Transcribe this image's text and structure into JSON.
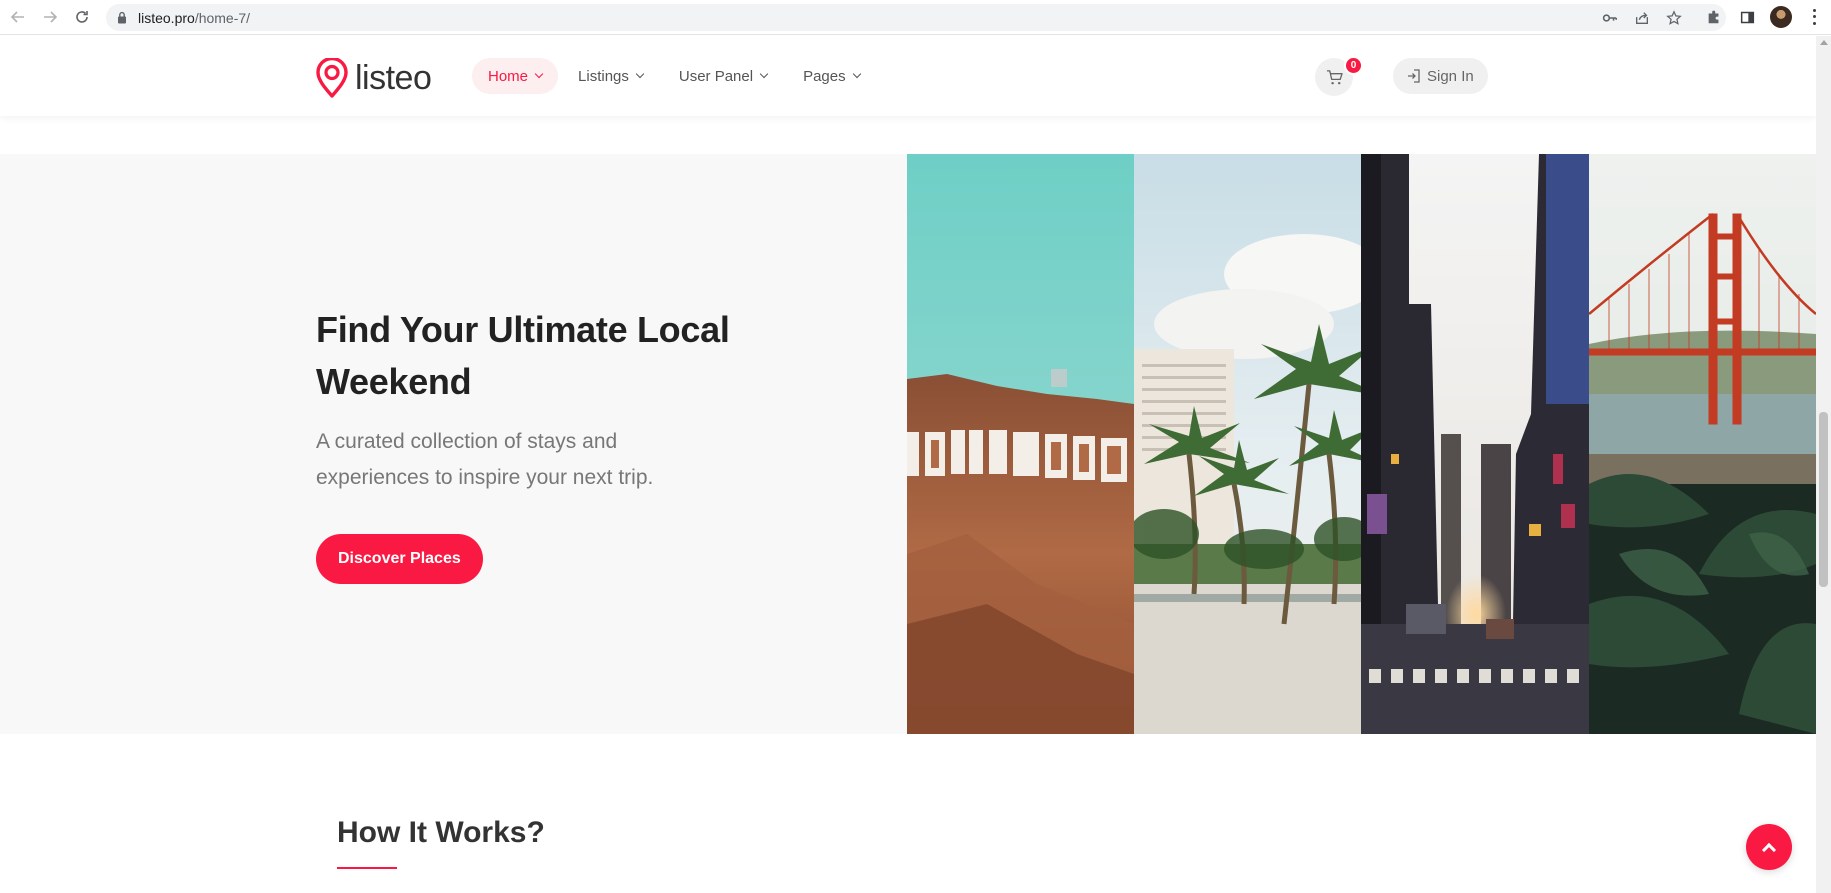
{
  "browser": {
    "url_host": "listeo.pro",
    "url_path": "/home-7/",
    "icons": [
      "back-icon",
      "forward-icon",
      "reload-icon",
      "lock-icon",
      "key-icon",
      "share-icon",
      "star-icon",
      "extensions-icon",
      "sidepanel-icon",
      "profile-avatar",
      "menu-icon"
    ]
  },
  "header": {
    "logo_text": "listeo",
    "menu": [
      {
        "label": "Home",
        "active": true
      },
      {
        "label": "Listings",
        "active": false
      },
      {
        "label": "User Panel",
        "active": false
      },
      {
        "label": "Pages",
        "active": false
      }
    ],
    "cart_count": "0",
    "signin_label": "Sign In"
  },
  "hero": {
    "title": "Find Your Ultimate Local Weekend",
    "subtitle": "A curated collection of stays and experiences to inspire your next trip.",
    "button_label": "Discover Places",
    "panels": [
      "hollywood-image",
      "palm-beach-image",
      "city-street-image",
      "golden-gate-image"
    ]
  },
  "how": {
    "title": "How It Works?"
  },
  "colors": {
    "accent": "#f91942",
    "hero_bg": "#f8f8f8"
  }
}
